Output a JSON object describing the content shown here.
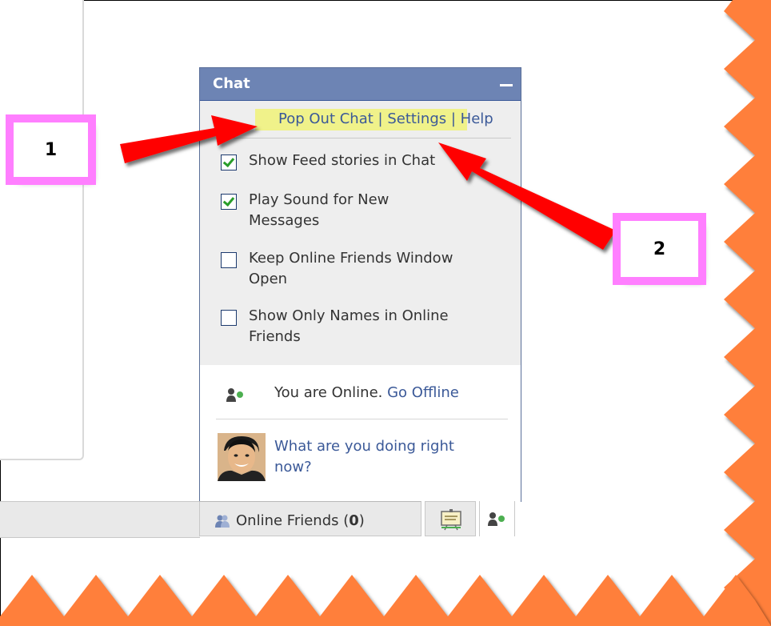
{
  "chat": {
    "title": "Chat",
    "links": {
      "pop_out": "Pop Out Chat",
      "sep1": " | ",
      "settings": "Settings",
      "sep2": " | ",
      "help": "Help"
    },
    "options": [
      {
        "line1": "Show Feed stories in Chat",
        "line2": "",
        "checked": true
      },
      {
        "line1": "Play Sound for New",
        "line2": "Messages",
        "checked": true
      },
      {
        "line1": "Keep Online Friends Window",
        "line2": "Open",
        "checked": false
      },
      {
        "line1": "Show Only Names in Online",
        "line2": "Friends",
        "checked": false
      }
    ],
    "status_text": "You are Online.",
    "go_offline": "Go Offline",
    "status_question_line1": "What are you doing right",
    "status_question_line2": "now?"
  },
  "chat_bar": {
    "online_friends_label": "Online Friends (",
    "online_count": "0",
    "online_friends_close": ")"
  },
  "callouts": {
    "one": "1",
    "two": "2"
  },
  "colors": {
    "header_blue": "#6d84b4",
    "link_blue": "#3b5998",
    "callout_border": "#ff7fff",
    "arrow_red": "#ff0000",
    "zigzag_orange": "#ff7f3a",
    "online_green": "#4caf50"
  }
}
